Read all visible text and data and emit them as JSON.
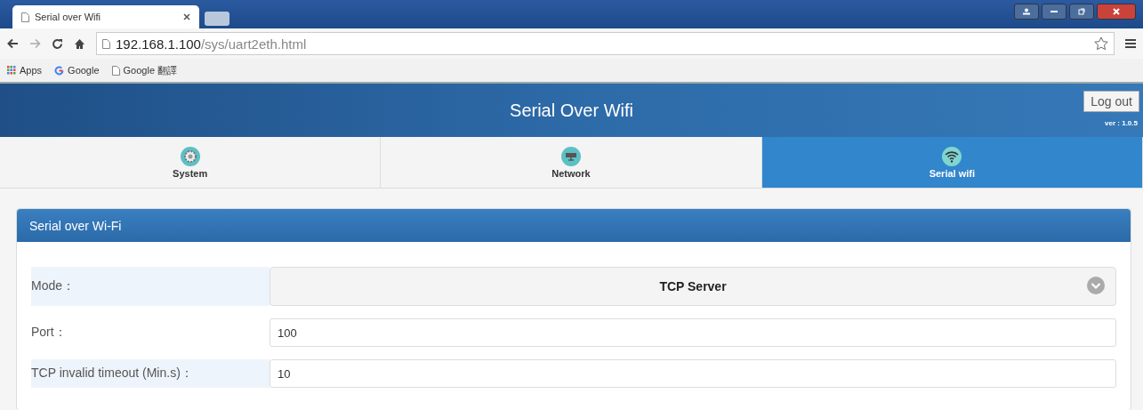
{
  "browser": {
    "tab_title": "Serial over Wifi",
    "url_host": "192.168.1.100",
    "url_path": "/sys/uart2eth.html",
    "bookmarks": [
      {
        "label": "Apps",
        "kind": "apps"
      },
      {
        "label": "Google",
        "kind": "google"
      },
      {
        "label": "Google 翻譯",
        "kind": "page"
      }
    ]
  },
  "header": {
    "title": "Serial Over Wifi",
    "logout": "Log out",
    "version": "ver : 1.0.5"
  },
  "nav": [
    {
      "label": "System",
      "kind": "gear",
      "selected": false
    },
    {
      "label": "Network",
      "kind": "network",
      "selected": false
    },
    {
      "label": "Serial wifi",
      "kind": "wifi",
      "selected": true
    }
  ],
  "panel": {
    "title": "Serial over Wi-Fi",
    "fields": [
      {
        "label": "Mode：",
        "kind": "select",
        "value": "TCP Server"
      },
      {
        "label": "Port：",
        "kind": "input",
        "value": "100"
      },
      {
        "label": "TCP invalid timeout (Min.s)：",
        "kind": "input",
        "value": "10"
      }
    ]
  }
}
